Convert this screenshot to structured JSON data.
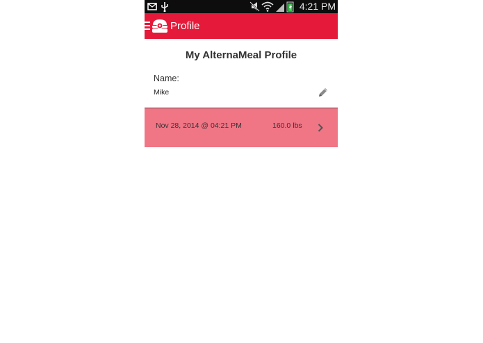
{
  "status_bar": {
    "time": "4:21 PM",
    "left_icons": [
      "mail-icon",
      "usb-icon"
    ],
    "right_icons": [
      "mute-icon",
      "wifi-icon",
      "signal-icon",
      "battery-icon"
    ]
  },
  "app_bar": {
    "title": "Profile",
    "background": "#e5193a",
    "icons": [
      "menu-icon",
      "burger-logo-icon"
    ]
  },
  "profile": {
    "heading": "My AlternaMeal Profile",
    "name_label": "Name:",
    "name_value": "Mike",
    "edit_icon": "pencil-icon"
  },
  "entries": [
    {
      "date": "Nov 28, 2014 @ 04:21 PM",
      "weight": "160.0 lbs",
      "icon": "chevron-right-icon"
    }
  ],
  "colors": {
    "accent": "#e5193a",
    "entry_row": "#f07585"
  }
}
